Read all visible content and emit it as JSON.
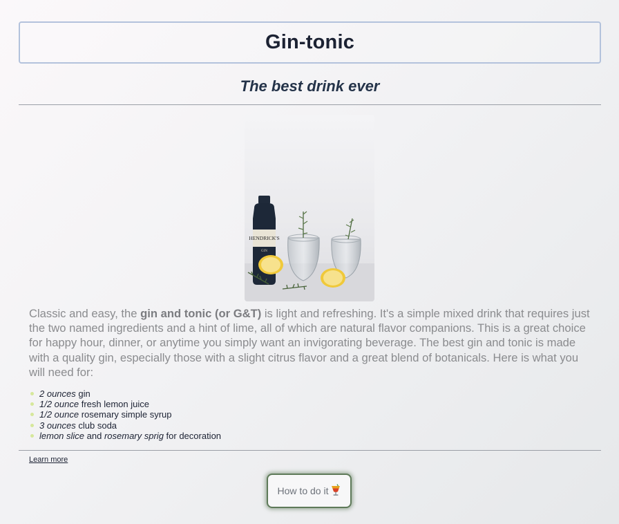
{
  "header": {
    "title": "Gin-tonic",
    "subtitle": "The best drink ever"
  },
  "image": {
    "alt": "Hendrick's gin bottle with two gin and tonic glasses, lemon halves and rosemary",
    "bottle_label": "HENDRICK'S",
    "bottle_sublabel": "GIN"
  },
  "intro": {
    "before_bold": "Classic and easy, the ",
    "bold": "gin and tonic (or G&T)",
    "after_bold": " is light and refreshing. It's a simple mixed drink that requires just the two named ingredients and a hint of lime, all of which are natural flavor companions. This is a great choice for happy hour, dinner, or anytime you simply want an invigorating beverage. The best gin and tonic is made with a quality gin, especially those with a slight citrus flavor and a great blend of botanicals. Here is what you will need for:"
  },
  "ingredients": [
    {
      "em": "2 ounces",
      "rest": " gin"
    },
    {
      "em": "1/2 ounce",
      "rest": " fresh lemon juice"
    },
    {
      "em": "1/2 ounce",
      "rest": " rosemary simple syrup"
    },
    {
      "em": "3 ounces",
      "rest": " club soda"
    },
    {
      "em": "lemon slice",
      "mid": " and ",
      "em2": "rosemary sprig",
      "rest": " for decoration"
    }
  ],
  "links": {
    "learn_more": "Learn more"
  },
  "button": {
    "label": "How to do it",
    "icon": "tropical-drink-icon"
  },
  "colors": {
    "title_border": "#b3c2dc",
    "button_border": "#5e7a59",
    "bullet": "#d6e79b",
    "body_text": "#8a8b8e"
  }
}
